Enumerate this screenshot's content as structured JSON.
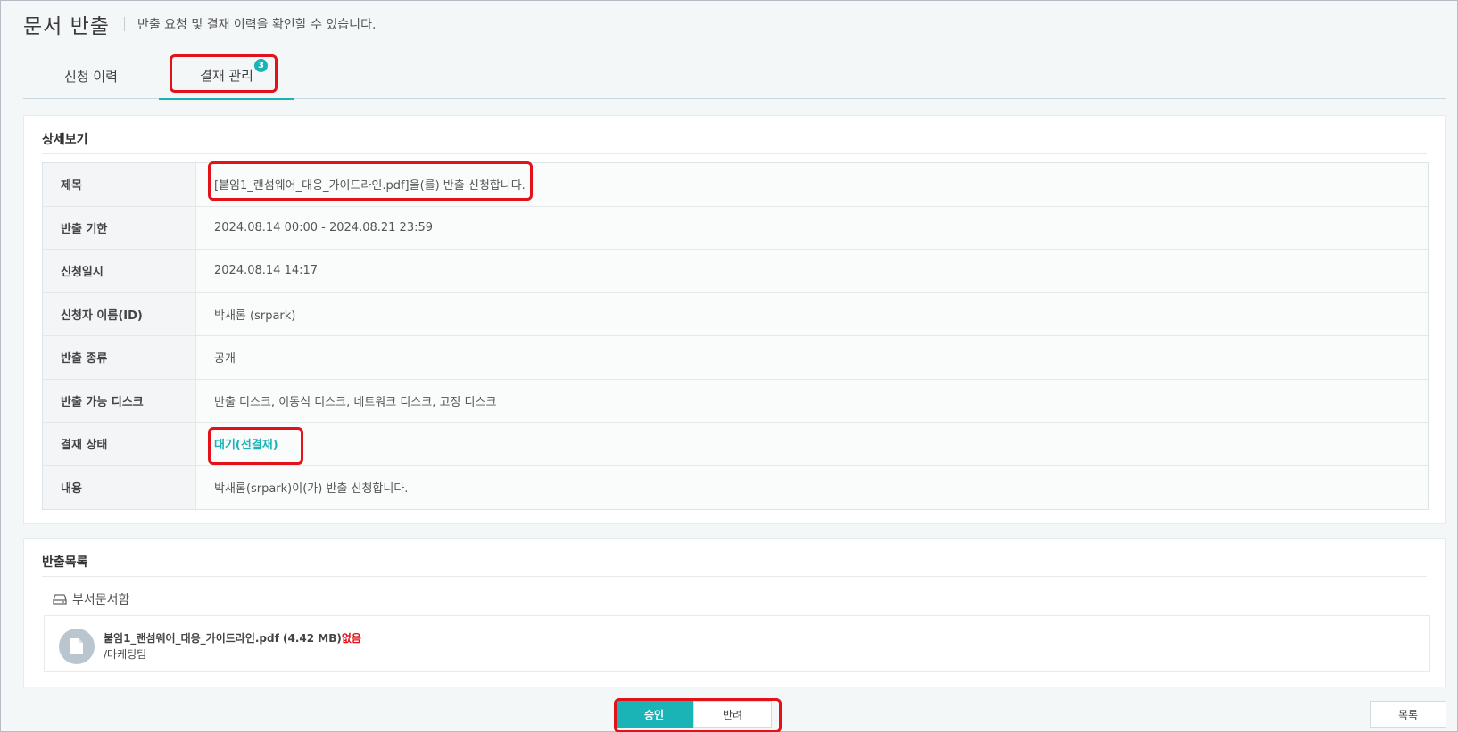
{
  "header": {
    "title": "문서 반출",
    "subtitle": "반출 요청 및 결재 이력을 확인할 수 있습니다."
  },
  "tabs": [
    {
      "label": "신청 이력"
    },
    {
      "label": "결재 관리",
      "badge": "3",
      "active": true
    }
  ],
  "detail": {
    "title": "상세보기",
    "rows": [
      {
        "label": "제목",
        "value": "[붙임1_랜섬웨어_대응_가이드라인.pdf]을(를) 반출 신청합니다."
      },
      {
        "label": "반출 기한",
        "value": "2024.08.14 00:00 - 2024.08.21 23:59"
      },
      {
        "label": "신청일시",
        "value": "2024.08.14 14:17"
      },
      {
        "label": "신청자 이름(ID)",
        "value": "박새롬 (srpark)"
      },
      {
        "label": "반출 종류",
        "value": "공개"
      },
      {
        "label": "반출 가능 디스크",
        "value": "반출 디스크, 이동식 디스크, 네트워크 디스크, 고정 디스크"
      },
      {
        "label": "결재 상태",
        "value": "대기(선결재)"
      },
      {
        "label": "내용",
        "value": "박새롬(srpark)이(가) 반출 신청합니다."
      }
    ]
  },
  "export_list": {
    "title": "반출목록",
    "folder": "부서문서함",
    "file": {
      "name": "붙임1_랜섬웨어_대응_가이드라인.pdf (4.42 MB)",
      "missing": "없음",
      "path": "/마케팅팀"
    }
  },
  "actions": {
    "approve": "승인",
    "reject": "반려",
    "list": "목록"
  },
  "colors": {
    "accent": "#1ab3b6",
    "highlight": "#e2111a",
    "missing": "#e2111a"
  }
}
